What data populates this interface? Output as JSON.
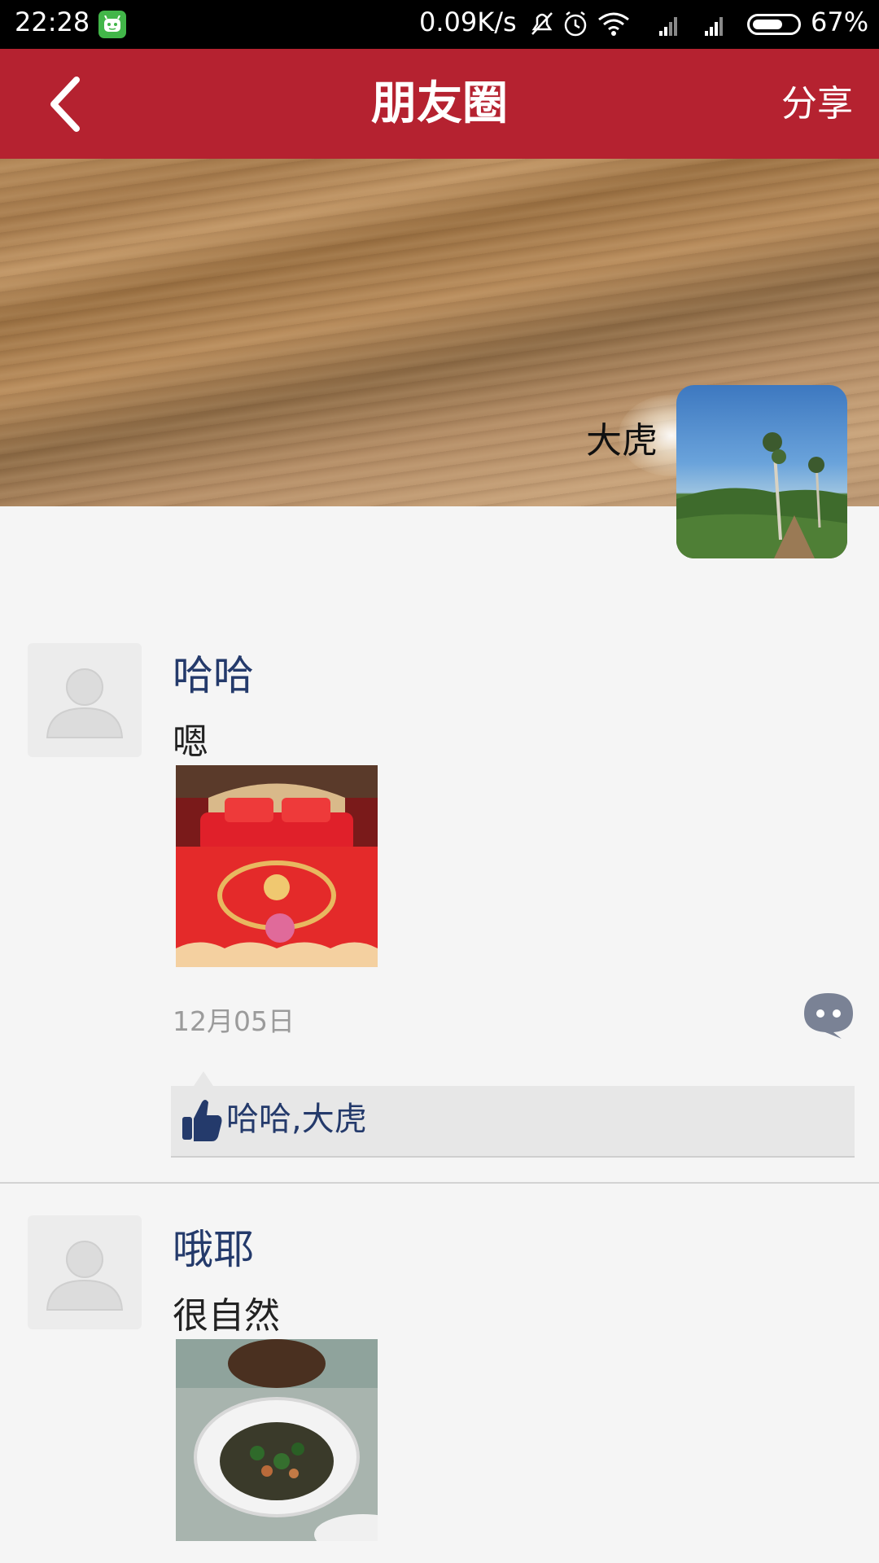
{
  "status_bar": {
    "time": "22:28",
    "network_speed": "0.09K/s",
    "battery_percent": "67%",
    "battery_level": 0.67
  },
  "app_bar": {
    "title": "朋友圈",
    "share_label": "分享"
  },
  "profile": {
    "username": "大虎"
  },
  "posts": [
    {
      "author": "哈哈",
      "text": "嗯",
      "date": "12月05日",
      "likes": "哈哈,大虎"
    },
    {
      "author": "哦耶",
      "text": "很自然"
    }
  ],
  "colors": {
    "app_bar": "#b52230",
    "name_link": "#243a6b",
    "background": "#f5f5f5"
  }
}
